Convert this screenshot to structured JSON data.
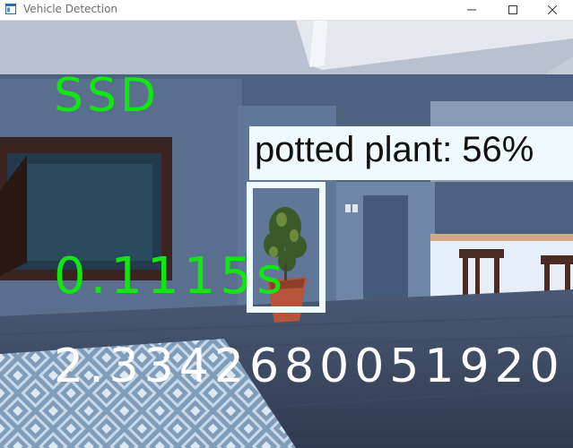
{
  "window": {
    "title": "Vehicle Detection",
    "icon": "app-window-icon",
    "controls": [
      "minimize-icon",
      "maximize-icon",
      "close-icon"
    ]
  },
  "overlay": {
    "model_name": "SSD",
    "inference_time": "0.1115s",
    "raw_value": "2.3342680051920"
  },
  "detection": {
    "label": "potted plant: 56%",
    "class": "potted plant",
    "confidence_percent": 56,
    "box_color": "#eefaff"
  },
  "colors": {
    "model_text": "#12e612",
    "time_text": "#12e612",
    "raw_text": "#ffffff"
  }
}
